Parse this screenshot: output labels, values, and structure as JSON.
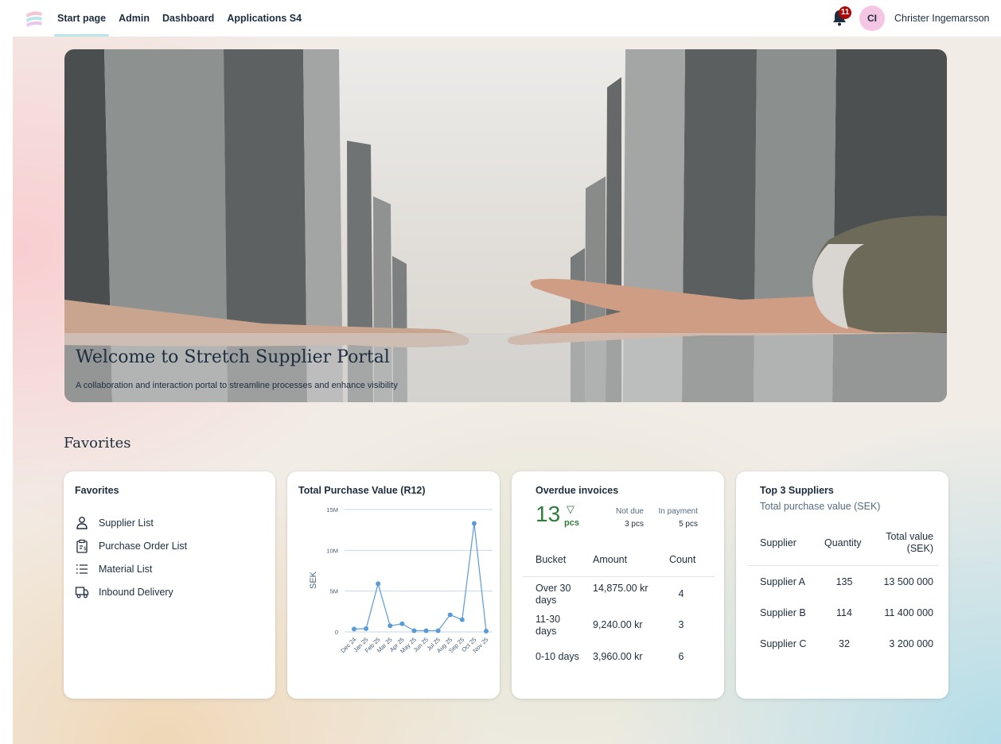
{
  "shell": {
    "nav": [
      "Start page",
      "Admin",
      "Dashboard",
      "Applications S4"
    ],
    "active_nav": "Start page",
    "notifications": "11",
    "user_initials": "CI",
    "user_name": "Christer Ingemarsson",
    "accent": "#b8e6ea",
    "badge_color": "#aa0808",
    "avatar_color": "#f5c6e3"
  },
  "hero": {
    "title": "Welcome to Stretch Supplier Portal",
    "subtitle": "A collaboration and interaction portal to streamline processes and enhance visibility"
  },
  "section_title": "Favorites",
  "favorites": {
    "title": "Favorites",
    "items": [
      {
        "label": "Supplier List",
        "icon": "person-icon"
      },
      {
        "label": "Purchase Order List",
        "icon": "clipboard-icon"
      },
      {
        "label": "Material List",
        "icon": "list-icon"
      },
      {
        "label": "Inbound Delivery",
        "icon": "truck-icon"
      }
    ]
  },
  "purchase_chart": {
    "title": "Total Purchase Value (R12)",
    "ylabel": "SEK"
  },
  "chart_data": {
    "type": "line",
    "title": "Total Purchase Value (R12)",
    "xlabel": "",
    "ylabel": "SEK",
    "categories": [
      "Dec 24",
      "Jan 25",
      "Feb 25",
      "Mar 25",
      "Apr 25",
      "May 25",
      "Jun 25",
      "Jul 25",
      "Aug 25",
      "Sep 25",
      "Oct 25",
      "Nov 25"
    ],
    "x": [
      "Dec 24",
      "Jan 25",
      "Feb 25",
      "Mar 25",
      "Apr 25",
      "May 25",
      "Jun 25",
      "Jul 25",
      "Aug 25",
      "Sep 25",
      "Oct 25",
      "Nov 25"
    ],
    "values": [
      0.35,
      0.4,
      5.9,
      0.75,
      1.0,
      0.15,
      0.15,
      0.15,
      2.1,
      1.5,
      13.3,
      0.1
    ],
    "unit": "M",
    "yticks": [
      "0",
      "5M",
      "10M",
      "15M"
    ],
    "ylim": [
      0,
      15
    ],
    "grid": true,
    "color": "#5b9bd5"
  },
  "overdue": {
    "title": "Overdue invoices",
    "count": "13",
    "count_unit": "pcs",
    "trend_glyph": "▽",
    "not_due_label": "Not due",
    "not_due_value": "3 pcs",
    "in_payment_label": "In payment",
    "in_payment_value": "5 pcs",
    "headers": [
      "Bucket",
      "Amount",
      "Count"
    ],
    "rows": [
      {
        "bucket": "Over 30 days",
        "amount": "14,875.00 kr",
        "count": "4"
      },
      {
        "bucket": "11-30 days",
        "amount": "9,240.00 kr",
        "count": "3"
      },
      {
        "bucket": "0-10 days",
        "amount": "3,960.00 kr",
        "count": "6"
      }
    ],
    "positive_color": "#2f7d3a"
  },
  "top_suppliers": {
    "title": "Top 3 Suppliers",
    "subtitle": "Total purchase value (SEK)",
    "headers": [
      "Supplier",
      "Quantity",
      "Total value (SEK)"
    ],
    "rows": [
      {
        "supplier": "Supplier A",
        "quantity": "135",
        "total": "13 500 000"
      },
      {
        "supplier": "Supplier B",
        "quantity": "114",
        "total": "11 400 000"
      },
      {
        "supplier": "Supplier C",
        "quantity": "32",
        "total": "3 200 000"
      }
    ]
  }
}
